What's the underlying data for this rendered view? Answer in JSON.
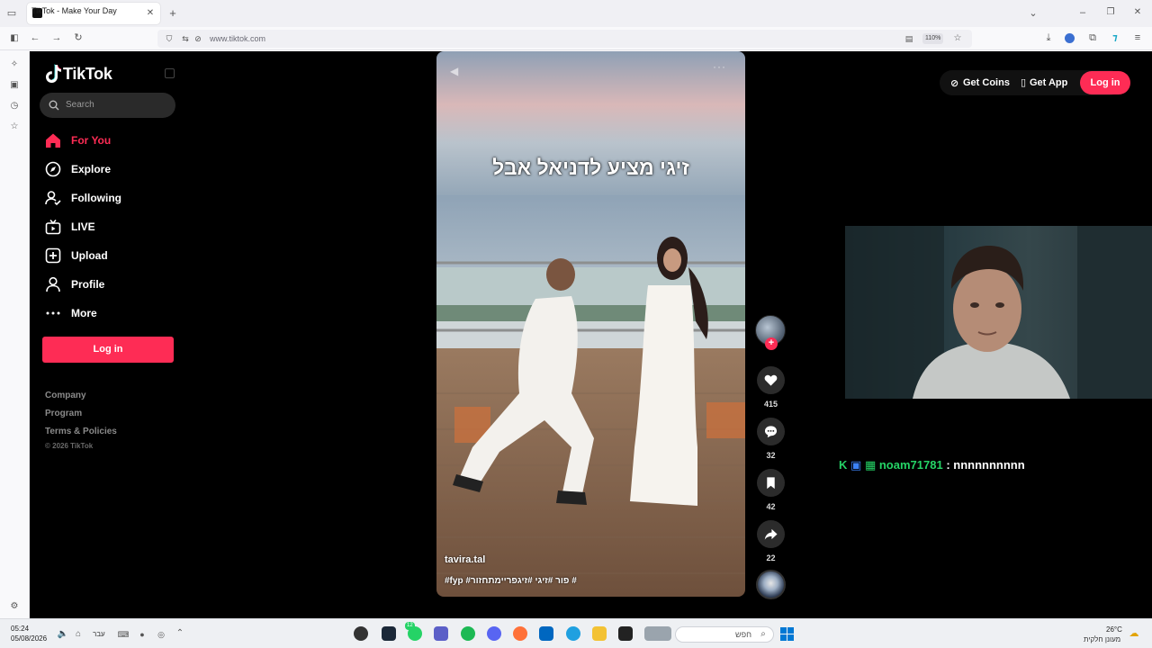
{
  "browser": {
    "tab_title": "TikTok - Make Your Day",
    "url": "www.tiktok.com",
    "zoom": "110%"
  },
  "sidebar": {
    "logo_text": "TikTok",
    "search_placeholder": "Search",
    "nav": [
      {
        "label": "For You",
        "icon": "home-icon",
        "active": true
      },
      {
        "label": "Explore",
        "icon": "compass-icon",
        "active": false
      },
      {
        "label": "Following",
        "icon": "following-icon",
        "active": false
      },
      {
        "label": "LIVE",
        "icon": "live-icon",
        "active": false
      },
      {
        "label": "Upload",
        "icon": "upload-icon",
        "active": false
      },
      {
        "label": "Profile",
        "icon": "profile-icon",
        "active": false
      },
      {
        "label": "More",
        "icon": "more-icon",
        "active": false
      }
    ],
    "login_label": "Log in",
    "footer": {
      "company": "Company",
      "program": "Program",
      "terms": "Terms & Policies",
      "copyright": "© 2026 TikTok"
    }
  },
  "header": {
    "get_coins": "Get Coins",
    "get_app": "Get App",
    "login": "Log in"
  },
  "video": {
    "overlay_caption": "זיגי מציע לדניאל אבל",
    "author": "tavira.tal",
    "hashtags": "#fyp #פור #זיגי #זיגפריימתחזור #",
    "likes": "415",
    "comments": "32",
    "bookmarks": "42",
    "shares": "22"
  },
  "stream_chat": {
    "username": "noam71781",
    "separator": ":",
    "message": "nnnnnnnnnn"
  },
  "taskbar": {
    "time": "05:24",
    "date": "05/08/2026",
    "lang": "עבר",
    "search_text": "חפש",
    "weather_temp": "26°C",
    "weather_desc": "מעונן חלקית",
    "badge_count": "12"
  },
  "colors": {
    "accent": "#fe2c55",
    "chat_user": "#25d366"
  }
}
